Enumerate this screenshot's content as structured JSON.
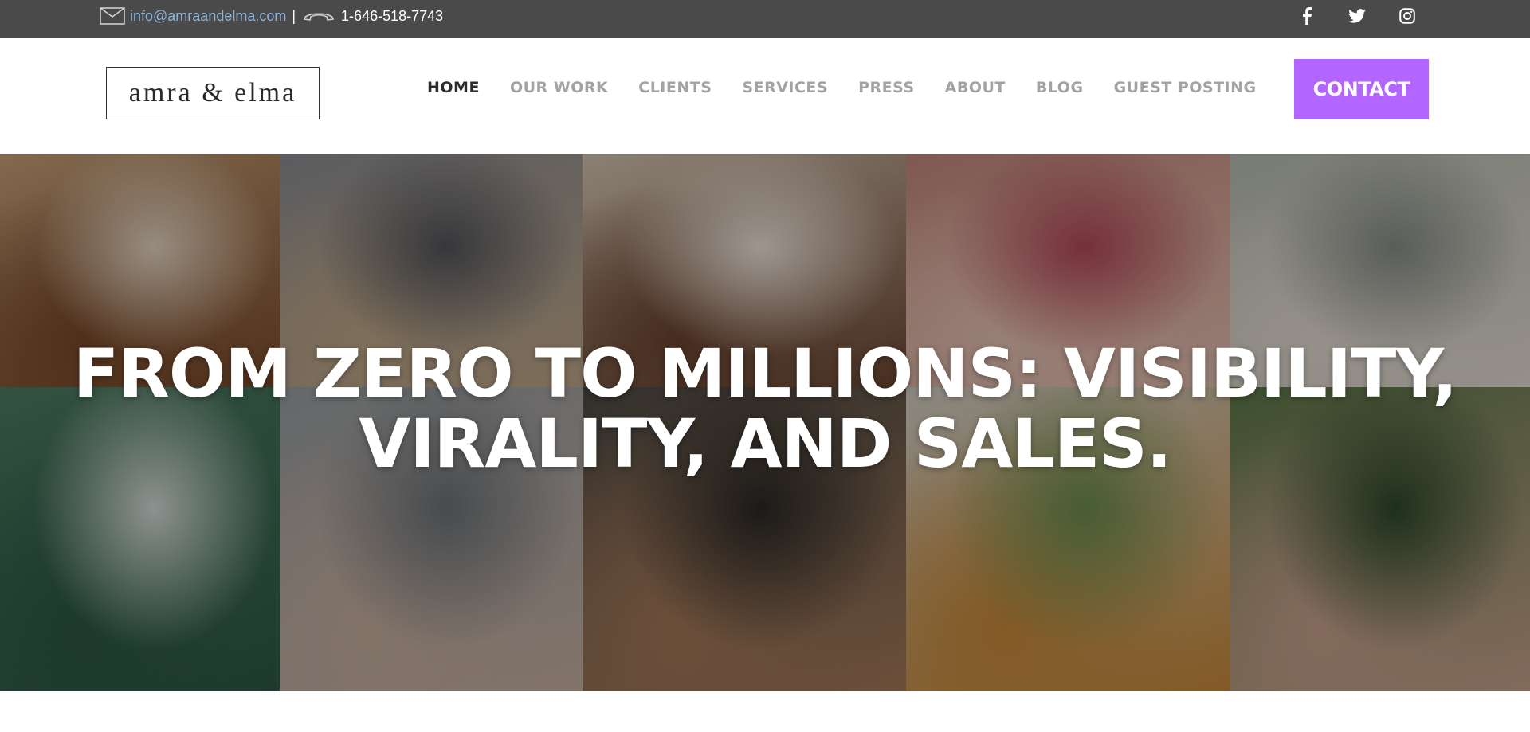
{
  "topbar": {
    "email": "info@amraandelma.com",
    "separator": "|",
    "phone": "1-646-518-7743",
    "mail_icon": "envelope-icon",
    "phone_icon": "telephone-icon",
    "socials": [
      {
        "name": "facebook",
        "glyph": "f"
      },
      {
        "name": "twitter",
        "glyph": "twitter-bird"
      },
      {
        "name": "instagram",
        "glyph": "instagram-camera"
      }
    ],
    "background_color": "#4a4a4a",
    "email_color": "#8fb6d8"
  },
  "header": {
    "logo_text": "amra & elma",
    "nav": [
      {
        "label": "HOME",
        "active": true
      },
      {
        "label": "OUR WORK",
        "active": false
      },
      {
        "label": "CLIENTS",
        "active": false
      },
      {
        "label": "SERVICES",
        "active": false
      },
      {
        "label": "PRESS",
        "active": false
      },
      {
        "label": "ABOUT",
        "active": false
      },
      {
        "label": "BLOG",
        "active": false
      },
      {
        "label": "GUEST POSTING",
        "active": false
      }
    ],
    "contact_label": "CONTACT",
    "contact_color": "#b266ff"
  },
  "hero": {
    "title_line1": "FROM ZERO TO MILLIONS: VISIBILITY,",
    "title_line2": "VIRALITY, AND SALES.",
    "tiles": [
      {
        "name": "hero-photo-two-women-fashion",
        "colors": [
          "#c9a27a",
          "#7a4a2a",
          "#e8d8c4"
        ]
      },
      {
        "name": "hero-photo-man-in-suit",
        "colors": [
          "#8e8f94",
          "#c2a98a",
          "#55565c"
        ]
      },
      {
        "name": "hero-photo-woman-lip-gloss",
        "colors": [
          "#d8c7b5",
          "#6b4530",
          "#f2e7dc"
        ]
      },
      {
        "name": "hero-photo-woman-lipstick-closeup",
        "colors": [
          "#c58a7e",
          "#e9c4b5",
          "#b54a5a"
        ]
      },
      {
        "name": "hero-photo-woman-eating-snack",
        "colors": [
          "#b9bfb3",
          "#e6ddd4",
          "#8a8f88"
        ]
      },
      {
        "name": "hero-photo-woman-tennis-court",
        "colors": [
          "#4f7d63",
          "#2d5a45",
          "#d9e0dc"
        ]
      },
      {
        "name": "hero-photo-woman-lace-dress",
        "colors": [
          "#9aa0a4",
          "#c9b2a2",
          "#6e7479"
        ]
      },
      {
        "name": "hero-photo-man-glasses",
        "colors": [
          "#4e4a44",
          "#a57a5a",
          "#2c2a27"
        ]
      },
      {
        "name": "hero-photo-power-up-snacks",
        "colors": [
          "#d5d2c8",
          "#c98b3a",
          "#6e8f4e"
        ]
      },
      {
        "name": "hero-photo-woman-skincare-box",
        "colors": [
          "#5f7a4a",
          "#caa48e",
          "#2f4a2c"
        ]
      }
    ]
  }
}
